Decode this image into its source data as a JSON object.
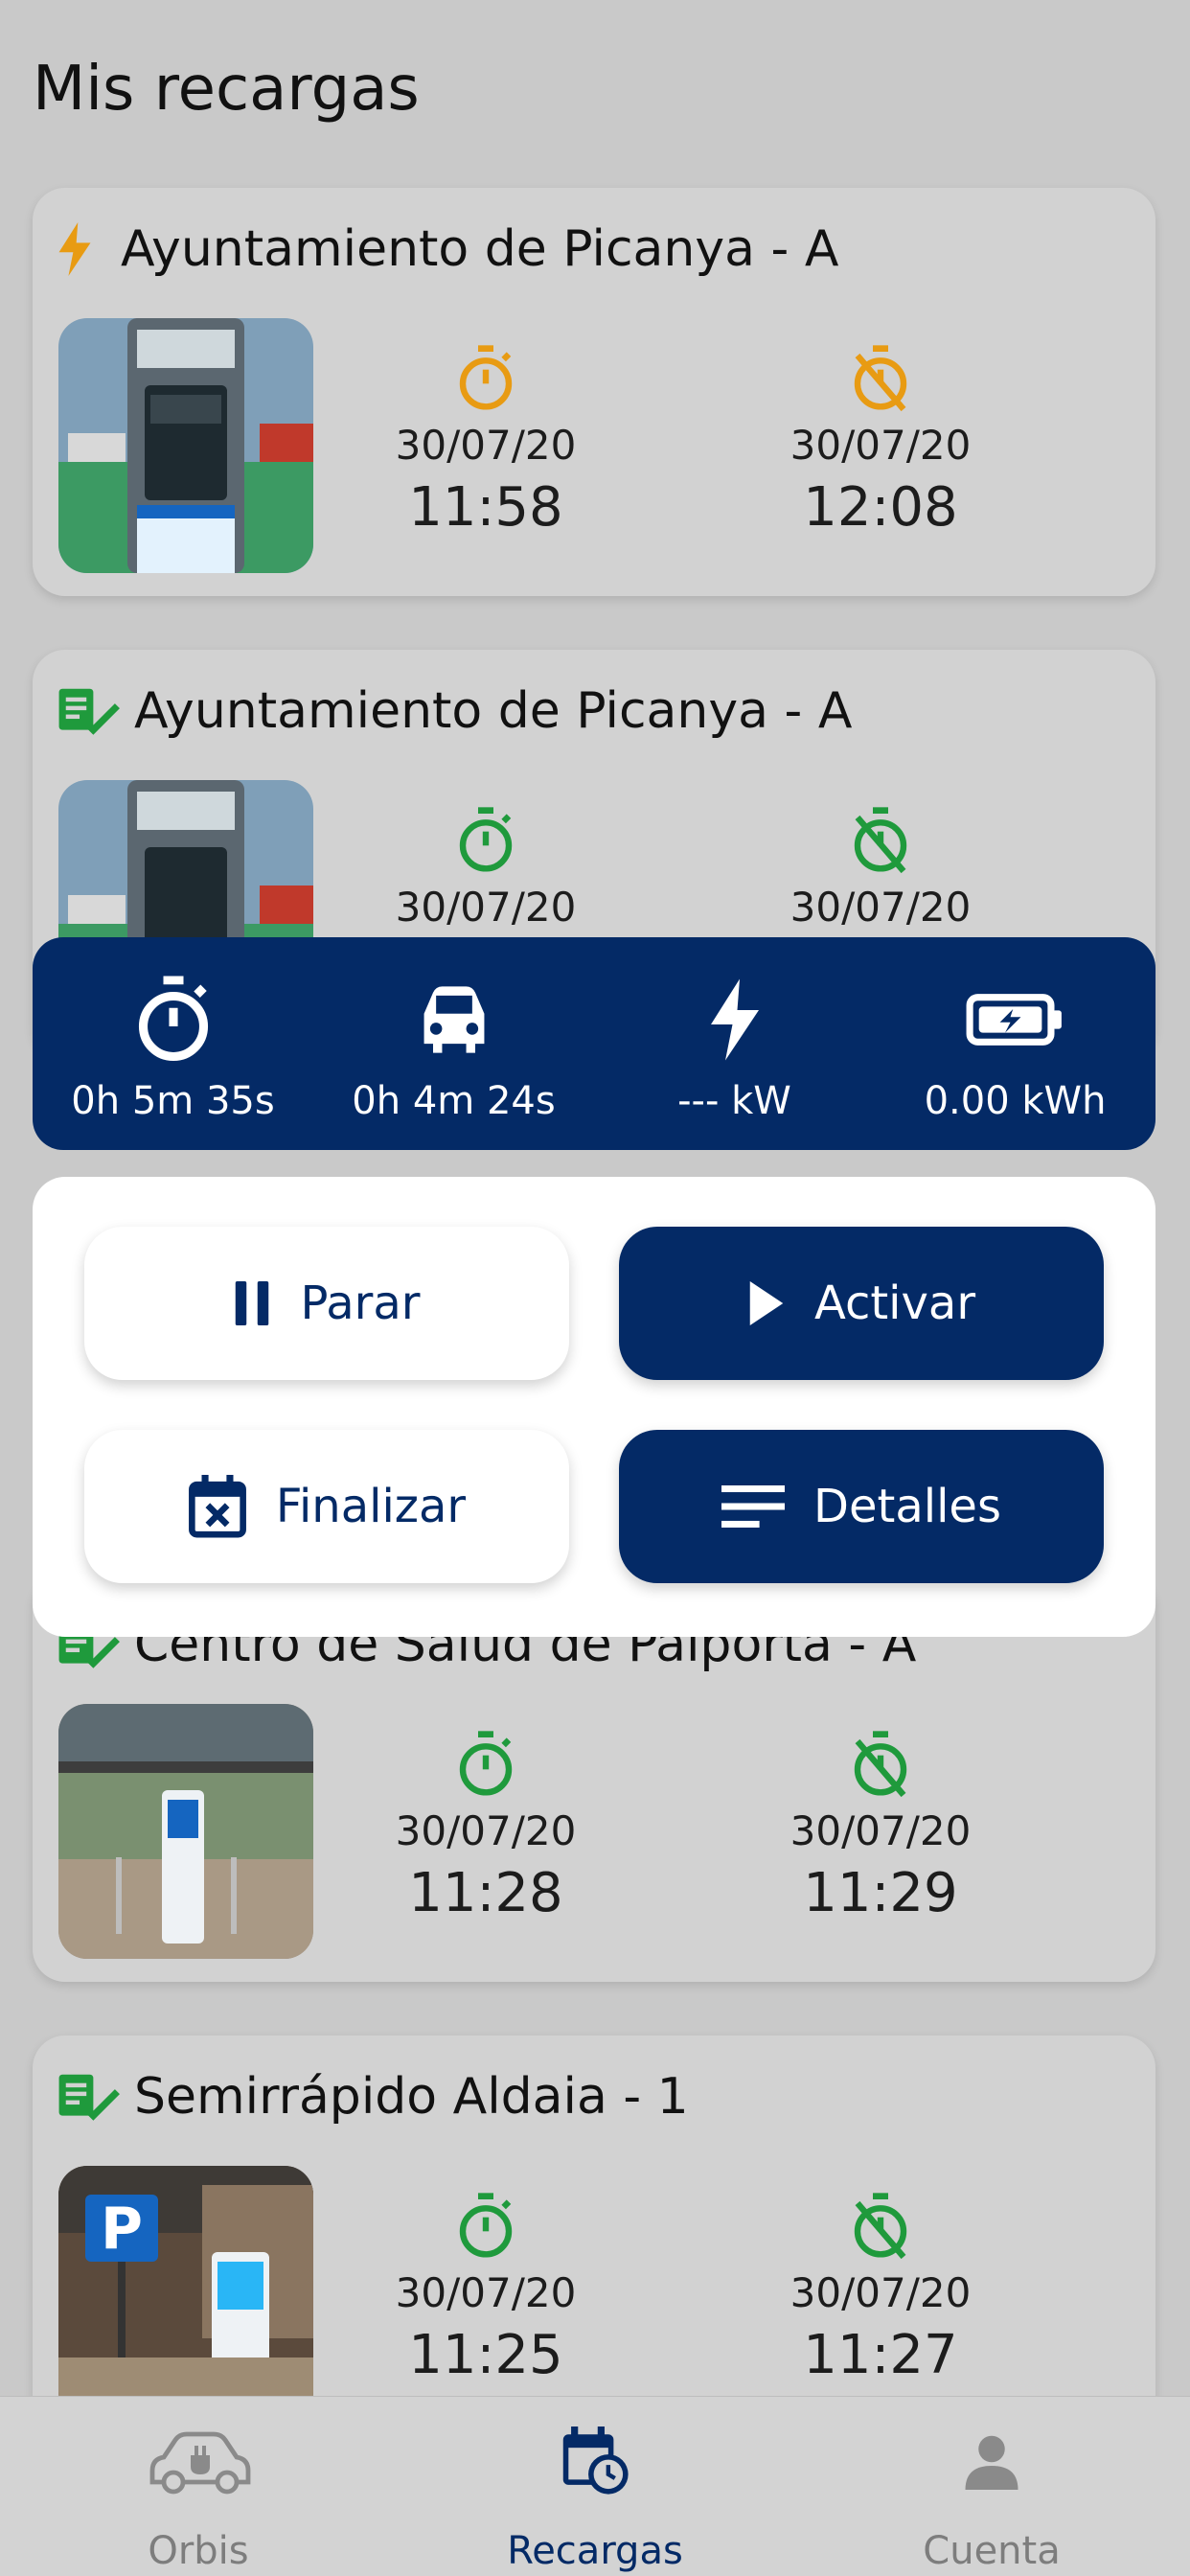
{
  "page": {
    "title": "Mis recargas"
  },
  "colors": {
    "accent": "#042a66",
    "active_orange": "#e89b13",
    "done_green": "#1f9a3c",
    "background": "#c9c9c9"
  },
  "recharges": [
    {
      "name": "Ayuntamiento de Picanya - A",
      "status": "active",
      "status_icon": "lightning-bolt-icon",
      "start_date": "30/07/20",
      "start_time": "11:58",
      "end_date": "30/07/20",
      "end_time": "12:08"
    },
    {
      "name": "Ayuntamiento de Picanya - A",
      "status": "finished",
      "status_icon": "checklist-icon",
      "start_date": "30/07/20",
      "start_time": "",
      "end_date": "30/07/20",
      "end_time": ""
    },
    {
      "name": "Centro de Salud de Paiporta - A",
      "status": "finished",
      "status_icon": "checklist-icon",
      "start_date": "30/07/20",
      "start_time": "11:28",
      "end_date": "30/07/20",
      "end_time": "11:29"
    },
    {
      "name": "Semirrápido Aldaia - 1",
      "status": "finished",
      "status_icon": "checklist-icon",
      "start_date": "30/07/20",
      "start_time": "11:25",
      "end_date": "30/07/20",
      "end_time": "11:27"
    }
  ],
  "stats": {
    "elapsed": "0h 5m 35s",
    "parked": "0h 4m 24s",
    "power": "--- kW",
    "energy": "0.00 kWh"
  },
  "actions": {
    "pause": "Parar",
    "activate": "Activar",
    "finish": "Finalizar",
    "details": "Detalles"
  },
  "nav": {
    "items": [
      {
        "label": "Orbis",
        "icon": "car-plug-icon",
        "active": false
      },
      {
        "label": "Recargas",
        "icon": "calendar-clock-icon",
        "active": true
      },
      {
        "label": "Cuenta",
        "icon": "user-icon",
        "active": false
      }
    ]
  }
}
